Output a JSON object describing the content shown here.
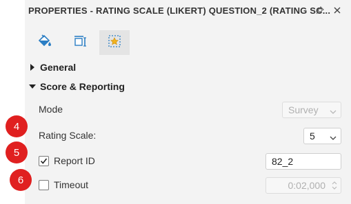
{
  "header": {
    "title": "PROPERTIES - RATING SCALE (LIKERT) QUESTION_2 (RATING SC..."
  },
  "tabs": [
    {
      "icon": "paint-bucket-icon"
    },
    {
      "icon": "text-frame-icon"
    },
    {
      "icon": "star-frame-icon",
      "active": true
    }
  ],
  "sections": {
    "general": {
      "label": "General",
      "expanded": false
    },
    "score_reporting": {
      "label": "Score & Reporting",
      "expanded": true
    }
  },
  "properties": {
    "mode": {
      "label": "Mode",
      "value": "Survey",
      "disabled": true
    },
    "rating_scale": {
      "label": "Rating Scale:",
      "value": "5"
    },
    "report_id": {
      "label": "Report ID",
      "checked": true,
      "value": "82_2"
    },
    "timeout": {
      "label": "Timeout",
      "checked": false,
      "value": "0:02,000",
      "disabled": true
    }
  },
  "callouts": {
    "c4": "4",
    "c5": "5",
    "c6": "6"
  },
  "colors": {
    "accent": "#2b7ec4",
    "callout": "#e02020",
    "panel_bg": "#f3f3f3"
  }
}
